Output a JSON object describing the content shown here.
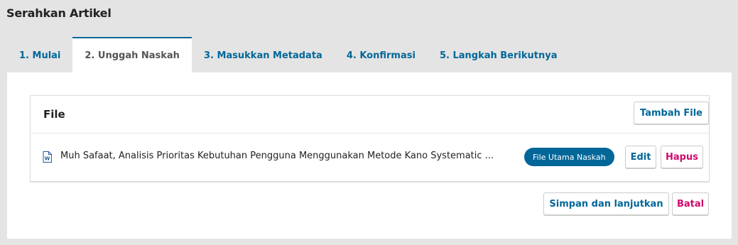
{
  "page": {
    "title": "Serahkan Artikel"
  },
  "tabs": [
    {
      "label": "1. Mulai",
      "active": false
    },
    {
      "label": "2. Unggah Naskah",
      "active": true
    },
    {
      "label": "3. Masukkan Metadata",
      "active": false
    },
    {
      "label": "4. Konfirmasi",
      "active": false
    },
    {
      "label": "5. Langkah Berikutnya",
      "active": false
    }
  ],
  "files_grid": {
    "title": "File",
    "add_button": "Tambah File",
    "rows": [
      {
        "icon": "word-document-icon",
        "name": "Muh Safaat, Analisis Prioritas Kebutuhan Pengguna Menggunakan Metode Kano Systematic ...",
        "badge": "File Utama Naskah",
        "edit_label": "Edit",
        "delete_label": "Hapus"
      }
    ]
  },
  "actions": {
    "save_continue": "Simpan dan lanjutkan",
    "cancel": "Batal"
  },
  "colors": {
    "primary": "#006798",
    "danger": "#d00a6c",
    "background": "#e4e4e4"
  }
}
